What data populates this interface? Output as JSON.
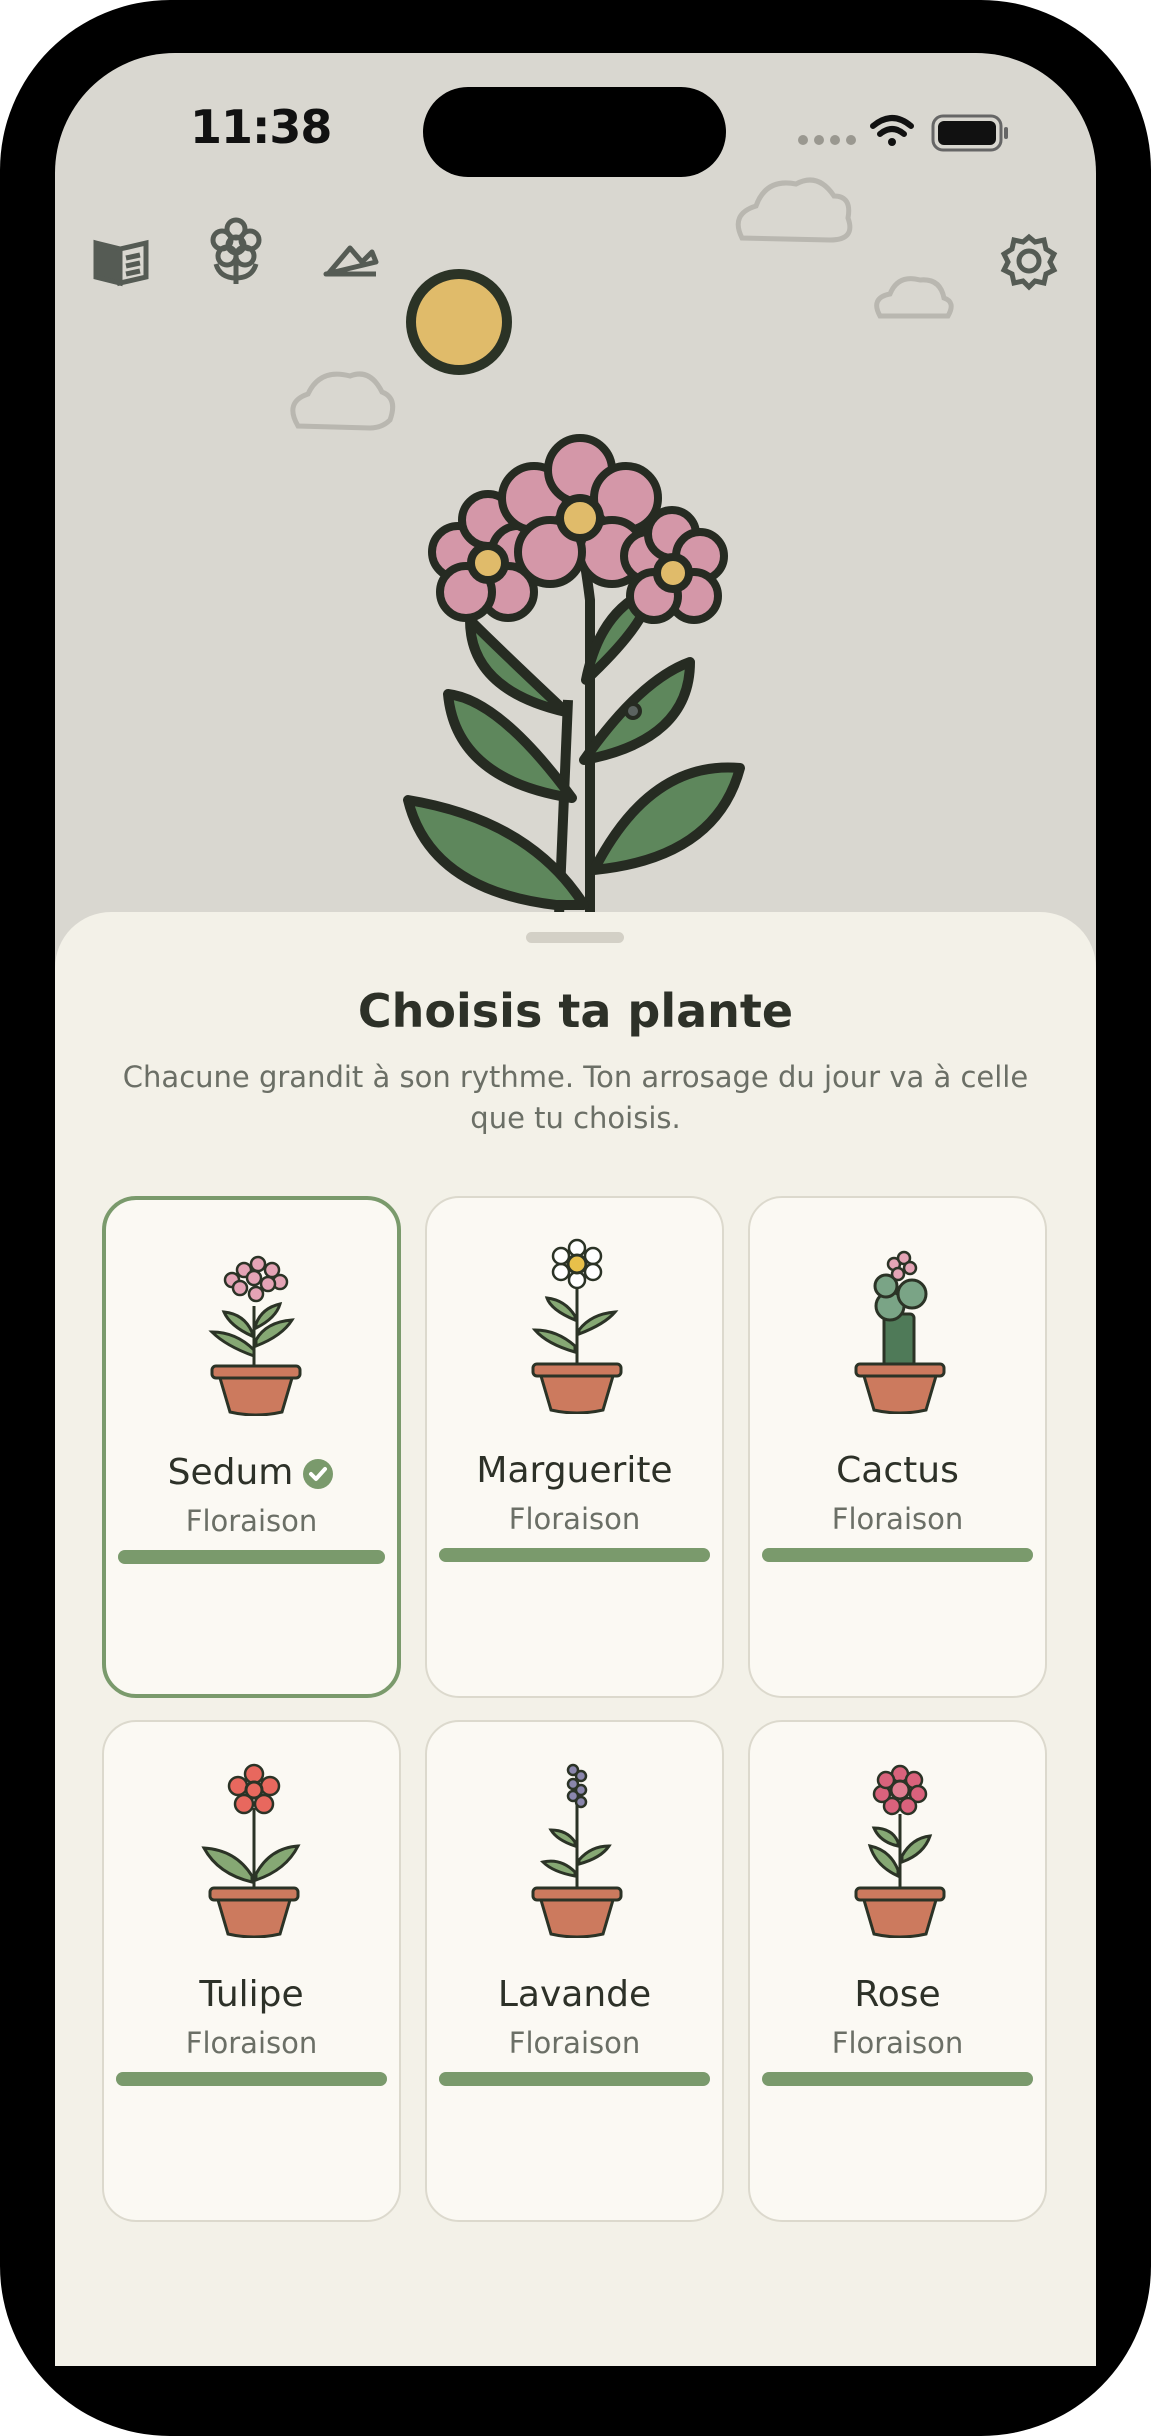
{
  "status_bar": {
    "time": "11:38"
  },
  "top_nav": {
    "icons": [
      "book-icon",
      "flower-icon",
      "mountains-icon",
      "gear-icon"
    ]
  },
  "sheet": {
    "title": "Choisis ta plante",
    "subtitle": "Chacune grandit à son rythme. Ton arrosage du jour va à celle que tu choisis."
  },
  "plants": [
    {
      "name": "Sedum",
      "stage": "Floraison",
      "progress": 1.0,
      "selected": true
    },
    {
      "name": "Marguerite",
      "stage": "Floraison",
      "progress": 1.0,
      "selected": false
    },
    {
      "name": "Cactus",
      "stage": "Floraison",
      "progress": 1.0,
      "selected": false
    },
    {
      "name": "Tulipe",
      "stage": "Floraison",
      "progress": 1.0,
      "selected": false
    },
    {
      "name": "Lavande",
      "stage": "Floraison",
      "progress": 1.0,
      "selected": false
    },
    {
      "name": "Rose",
      "stage": "Floraison",
      "progress": 1.0,
      "selected": false
    }
  ],
  "colors": {
    "accent": "#7a9a6c",
    "background": "#d9d7d0",
    "sheet": "#f3f1e8",
    "petal": "#d497a8",
    "leaf": "#5e875c",
    "pot": "#cc7a5e",
    "sun": "#e0bb6a"
  }
}
